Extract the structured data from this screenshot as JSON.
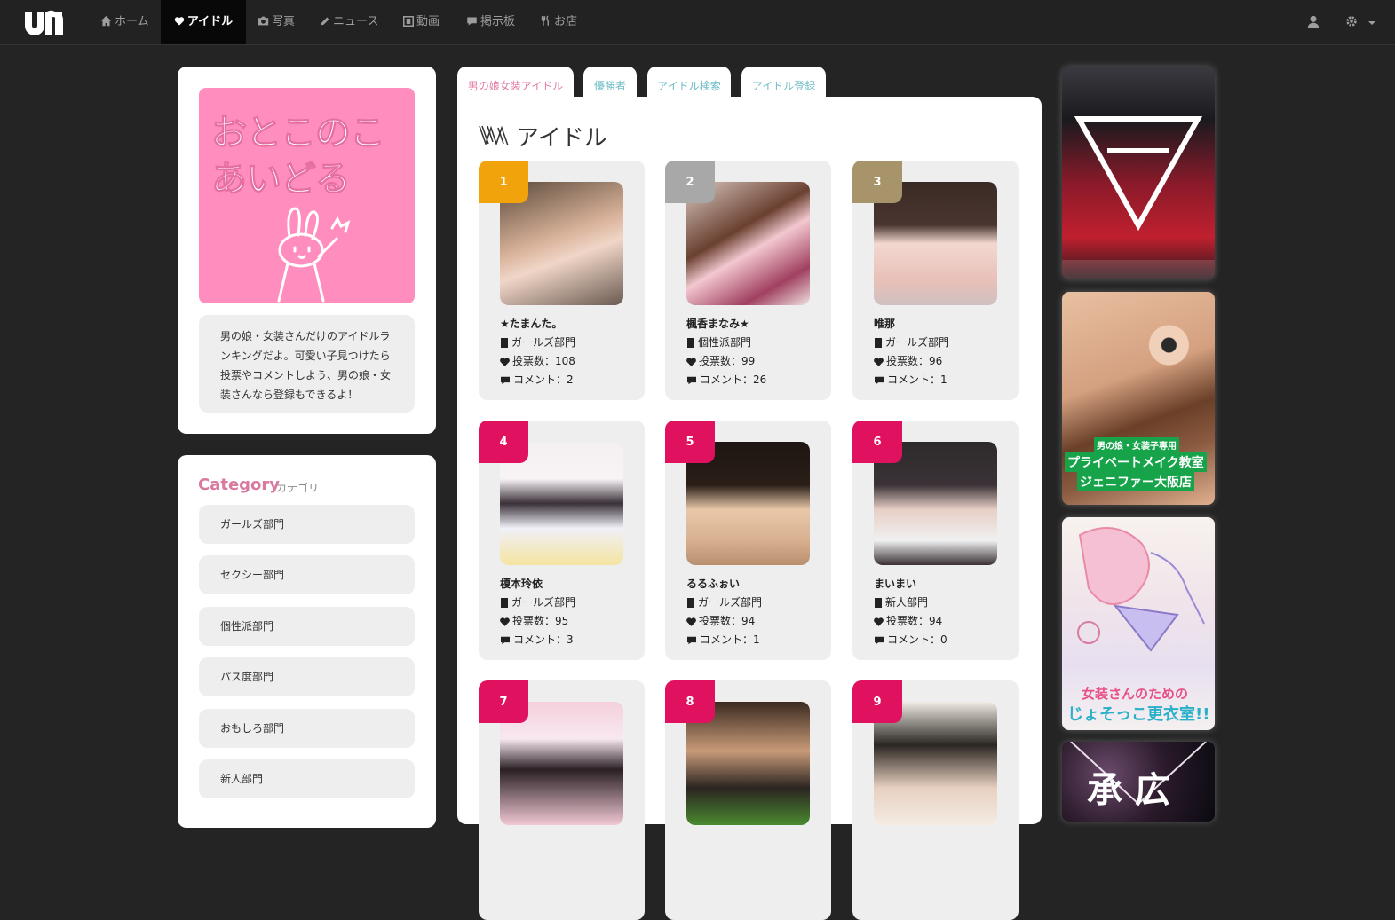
{
  "nav": {
    "items": [
      {
        "label": "ホーム",
        "icon": "home-icon"
      },
      {
        "label": "アイドル",
        "icon": "heart-icon"
      },
      {
        "label": "写真",
        "icon": "camera-icon"
      },
      {
        "label": "ニュース",
        "icon": "pencil-icon"
      },
      {
        "label": "動画",
        "icon": "film-icon"
      },
      {
        "label": "掲示板",
        "icon": "comment-icon"
      },
      {
        "label": "お店",
        "icon": "cutlery-icon"
      }
    ],
    "active_index": 1
  },
  "sidebar": {
    "hero_text": [
      "おとこのこ",
      "あいどる"
    ],
    "description": "男の娘・女装さんだけのアイドルランキングだよ。可愛い子見つけたら投票やコメントしよう、男の娘・女装さんなら登録もできるよ！",
    "category_title": "Category",
    "category_subtitle": "カテゴリ",
    "categories": [
      "ガールズ部門",
      "セクシー部門",
      "個性派部門",
      "パス度部門",
      "おもしろ部門",
      "新人部門"
    ]
  },
  "tabs": [
    "男の娘女装アイドル",
    "優勝者",
    "アイドル検索",
    "アイドル登録"
  ],
  "main": {
    "title": "アイドル",
    "idols": [
      {
        "rank": "1",
        "name": "★たまんた。",
        "category": "ガールズ部門",
        "votes": "投票数：108",
        "comments": "コメント：2"
      },
      {
        "rank": "2",
        "name": "楓香まなみ★",
        "category": "個性派部門",
        "votes": "投票数：99",
        "comments": "コメント：26"
      },
      {
        "rank": "3",
        "name": "唯那",
        "category": "ガールズ部門",
        "votes": "投票数：96",
        "comments": "コメント：1"
      },
      {
        "rank": "4",
        "name": "榎本玲依",
        "category": "ガールズ部門",
        "votes": "投票数：95",
        "comments": "コメント：3"
      },
      {
        "rank": "5",
        "name": "るるふぉい",
        "category": "ガールズ部門",
        "votes": "投票数：94",
        "comments": "コメント：1"
      },
      {
        "rank": "6",
        "name": "まいまい",
        "category": "新人部門",
        "votes": "投票数：94",
        "comments": "コメント：0"
      },
      {
        "rank": "7",
        "name": "",
        "category": "",
        "votes": "",
        "comments": ""
      },
      {
        "rank": "8",
        "name": "",
        "category": "",
        "votes": "",
        "comments": ""
      },
      {
        "rank": "9",
        "name": "",
        "category": "",
        "votes": "",
        "comments": ""
      }
    ]
  },
  "banners": {
    "b2_small": "男の娘・女装子専用",
    "b2_line1": "プライベートメイク教室",
    "b2_line2": "ジェニファー大阪店",
    "b3_line1": "女装さんのための",
    "b3_line2": "じょそっこ更衣室!!",
    "b4_text": "承 広"
  },
  "colors": {
    "rank_gold": "#f0a30a",
    "rank_silver": "#a8a8a8",
    "rank_bronze": "#a8946a",
    "rank_other": "#e0115f",
    "accent_pink": "#ff8dbe"
  }
}
